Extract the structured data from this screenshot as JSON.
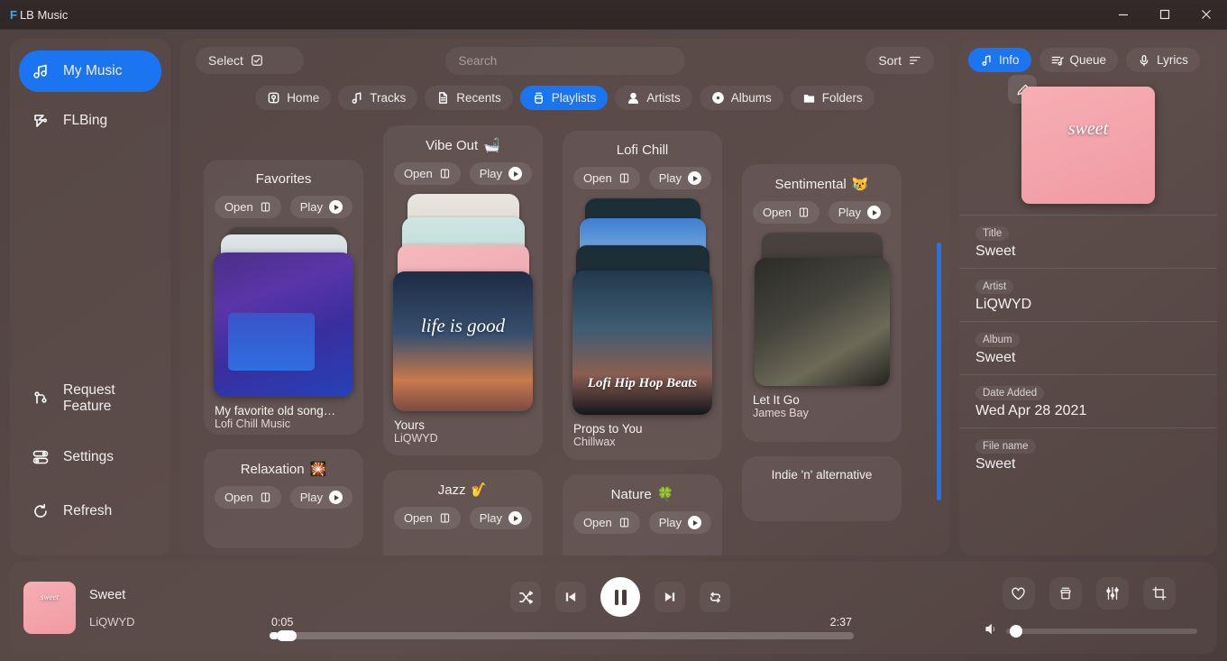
{
  "window": {
    "app_mark": "F",
    "title": "LB Music",
    "minimize_label": "Minimize",
    "maximize_label": "Maximize",
    "close_label": "Close"
  },
  "sidebar": {
    "primary": [
      {
        "label": "My Music",
        "icon": "music-note-icon",
        "active": true
      },
      {
        "label": "FLBing",
        "icon": "flbing-icon",
        "active": false
      }
    ],
    "bottom": [
      {
        "label": "Request Feature",
        "icon": "branch-icon"
      },
      {
        "label": "Settings",
        "icon": "sliders-icon"
      },
      {
        "label": "Refresh",
        "icon": "refresh-icon"
      }
    ]
  },
  "toolbar": {
    "select_label": "Select",
    "sort_label": "Sort",
    "search_placeholder": "Search",
    "search_value": ""
  },
  "tabs": [
    {
      "label": "Home",
      "icon": "home-icon",
      "active": false
    },
    {
      "label": "Tracks",
      "icon": "note-icon",
      "active": false
    },
    {
      "label": "Recents",
      "icon": "document-icon",
      "active": false
    },
    {
      "label": "Playlists",
      "icon": "playlist-icon",
      "active": true
    },
    {
      "label": "Artists",
      "icon": "person-icon",
      "active": false
    },
    {
      "label": "Albums",
      "icon": "disc-icon",
      "active": false
    },
    {
      "label": "Folders",
      "icon": "folder-icon",
      "active": false
    }
  ],
  "playlist_actions": {
    "open_label": "Open",
    "play_label": "Play"
  },
  "playlists": [
    {
      "name": "Favorites",
      "emoji": "",
      "track_title": "My favorite old song…",
      "track_artist": "Lofi Chill Music",
      "art": "art-bedroom",
      "art_label": "",
      "layers": [
        "art-beach",
        "art-gray"
      ]
    },
    {
      "name": "Vibe Out",
      "emoji": "🛁",
      "track_title": "Yours",
      "track_artist": "LiQWYD",
      "art": "art-life",
      "art_label": "life is good",
      "layers": [
        "art-cling",
        "art-mint",
        "art-pink"
      ]
    },
    {
      "name": "Lofi Chill",
      "emoji": "",
      "track_title": "Props to You",
      "track_artist": "Chillwax",
      "art": "art-lofi",
      "art_label": "Lofi Hip Hop Beats",
      "layers": [
        "art-dark",
        "art-sky",
        "art-dark"
      ]
    },
    {
      "name": "Sentimental",
      "emoji": "😿",
      "track_title": "Let It Go",
      "track_artist": "James Bay",
      "art": "art-bay",
      "art_label": "",
      "layers": [
        "art-gray"
      ]
    }
  ],
  "playlists_row2": [
    {
      "name": "Relaxation",
      "emoji": "🎇"
    },
    {
      "name": "Jazz",
      "emoji": "🎷"
    },
    {
      "name": "Nature",
      "emoji": "🍀"
    },
    {
      "name": "Indie 'n' alternative",
      "emoji": ""
    }
  ],
  "right_panel": {
    "tabs": [
      {
        "label": "Info",
        "icon": "note-icon",
        "active": true
      },
      {
        "label": "Queue",
        "icon": "queue-icon",
        "active": false
      },
      {
        "label": "Lyrics",
        "icon": "mic-icon",
        "active": false
      }
    ],
    "edit_art_label": "Edit artwork",
    "art_label": "sweet",
    "fields": [
      {
        "key": "Title",
        "value": "Sweet"
      },
      {
        "key": "Artist",
        "value": "LiQWYD"
      },
      {
        "key": "Album",
        "value": "Sweet"
      },
      {
        "key": "Date Added",
        "value": "Wed Apr 28 2021"
      },
      {
        "key": "File name",
        "value": "Sweet"
      }
    ]
  },
  "player": {
    "track_title": "Sweet",
    "track_artist": "LiQWYD",
    "art_label": "sweet",
    "current_time": "0:05",
    "total_time": "2:37",
    "progress_percent": 1.6,
    "volume_percent": 2,
    "controls": [
      {
        "name": "shuffle-button",
        "label": "Shuffle"
      },
      {
        "name": "previous-button",
        "label": "Previous"
      },
      {
        "name": "pause-button",
        "label": "Pause"
      },
      {
        "name": "next-button",
        "label": "Next"
      },
      {
        "name": "repeat-button",
        "label": "Repeat"
      }
    ],
    "extras": [
      {
        "name": "favorite-button",
        "label": "Favorite"
      },
      {
        "name": "archive-button",
        "label": "Archive"
      },
      {
        "name": "equalizer-button",
        "label": "Equalizer"
      },
      {
        "name": "miniplayer-button",
        "label": "Mini player"
      }
    ]
  },
  "colors": {
    "accent": "#1b74f0",
    "background": "#574846",
    "panel": "rgba(97,81,78,0.32)",
    "text": "#f1eceb",
    "scrollbar": "#1b74f0"
  }
}
